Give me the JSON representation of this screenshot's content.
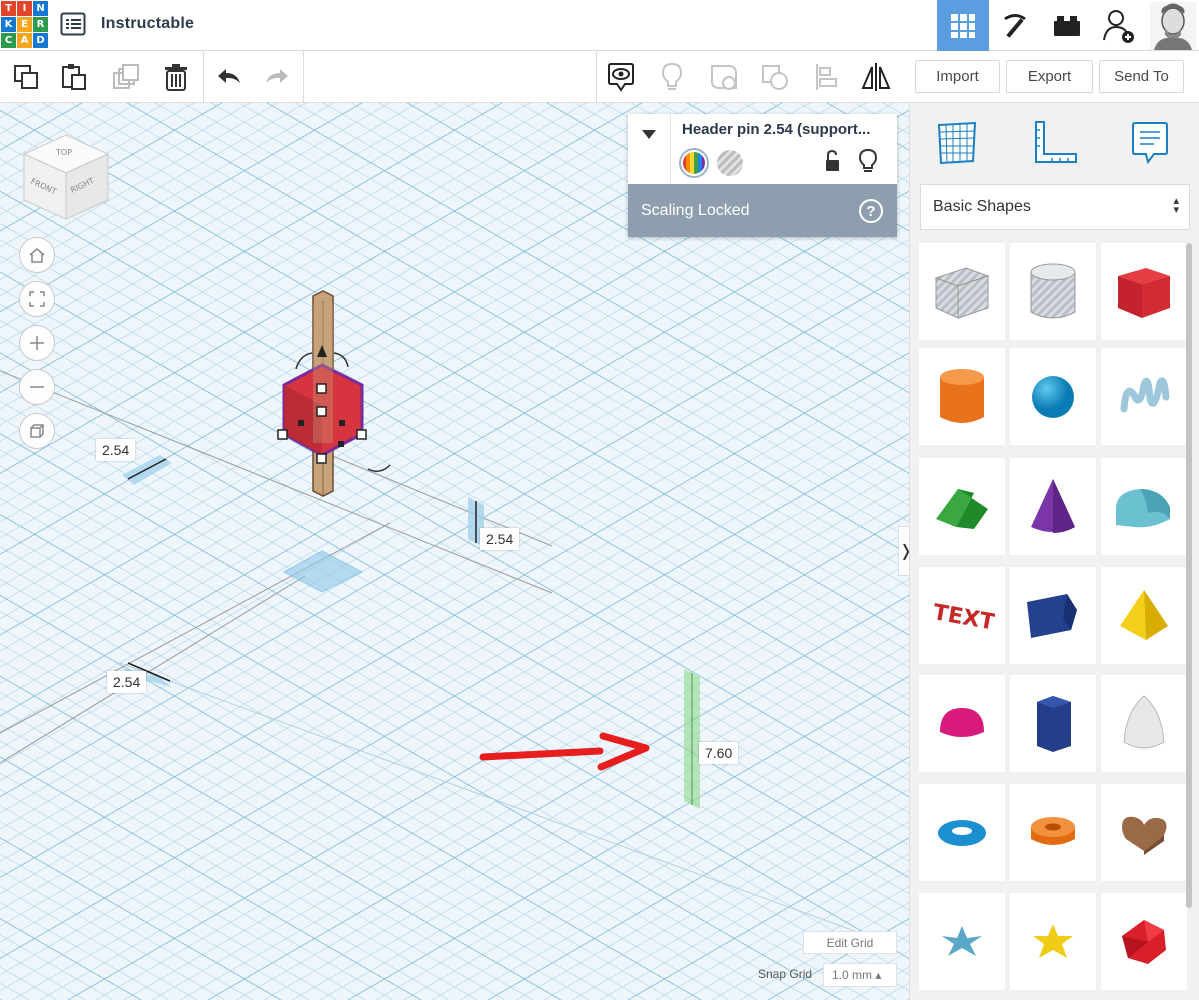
{
  "app": {
    "logo_letters": [
      "T",
      "I",
      "N",
      "K",
      "E",
      "R",
      "C",
      "A",
      "D"
    ],
    "logo_colors": [
      "#e1462b",
      "#e1462b",
      "#1477d1",
      "#1477d1",
      "#f7a620",
      "#2e9a4c",
      "#2e9a4c",
      "#f7a620",
      "#1477d1"
    ],
    "project_title": "Instructable",
    "accent_color": "#5a9de0"
  },
  "toolbar": {
    "import_label": "Import",
    "export_label": "Export",
    "send_to_label": "Send To"
  },
  "viewcube": {
    "top": "TOP",
    "front": "FRONT",
    "right": "RIGHT"
  },
  "dimensions": {
    "left_upper": "2.54",
    "right": "2.54",
    "left_lower": "2.54",
    "height": "7.60"
  },
  "inspector": {
    "shape_name": "Header pin 2.54 (support...",
    "status": "Scaling Locked",
    "help": "?"
  },
  "grid": {
    "edit_grid_label": "Edit Grid",
    "snap_grid_label": "Snap Grid",
    "snap_value": "1.0 mm ▴"
  },
  "panel": {
    "category": "Basic Shapes",
    "collapse_glyph": "❭",
    "shapes": [
      "box-hole",
      "cylinder-hole",
      "box",
      "cylinder",
      "sphere",
      "scribble",
      "roof",
      "cone",
      "round-roof",
      "text",
      "half-cylinder-prism",
      "pyramid",
      "half-sphere",
      "polygon",
      "paraboloid",
      "torus",
      "tube",
      "heart",
      "star",
      "star-solid",
      "icosahedron"
    ]
  }
}
